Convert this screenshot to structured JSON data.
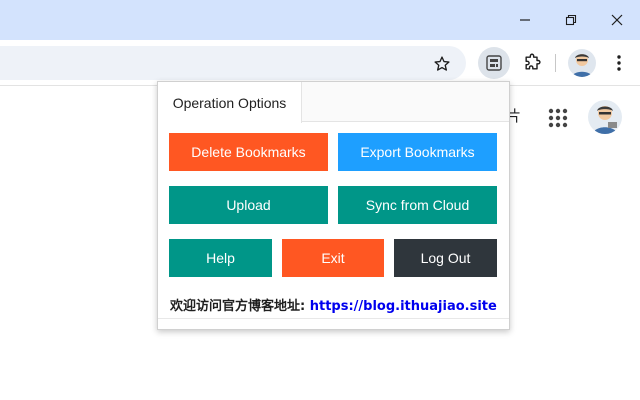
{
  "window": {
    "icons": [
      "minimize-icon",
      "restore-icon",
      "close-icon"
    ]
  },
  "toolbar": {
    "icons": [
      "star-icon",
      "bookmark-extension-icon",
      "puzzle-icon",
      "avatar",
      "kebab-menu-icon"
    ]
  },
  "page": {
    "snippet": "片"
  },
  "popup": {
    "tab_label": "Operation Options",
    "buttons": {
      "delete": "Delete Bookmarks",
      "export": "Export Bookmarks",
      "upload": "Upload",
      "sync": "Sync from Cloud",
      "help": "Help",
      "exit": "Exit",
      "logout": "Log Out"
    },
    "footer_label": "欢迎访问官方博客地址: ",
    "footer_link": "https://blog.ithuajiao.site"
  },
  "colors": {
    "red": "#ff5722",
    "blue": "#1e9fff",
    "teal": "#009688",
    "dark": "#2f363c",
    "titlebar": "#d3e3fd"
  }
}
